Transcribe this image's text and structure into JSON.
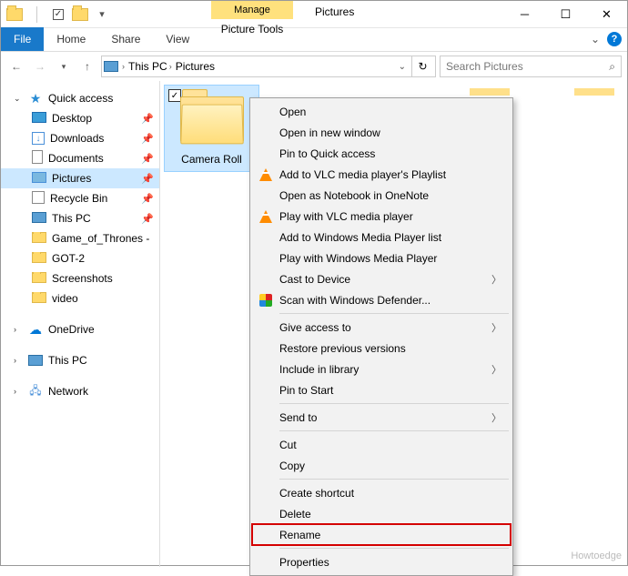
{
  "title": "Pictures",
  "ribbon": {
    "file": "File",
    "tabs": [
      "Home",
      "Share",
      "View"
    ],
    "contextual_top": "Manage",
    "contextual_bottom": "Picture Tools"
  },
  "address": {
    "segments": [
      "This PC",
      "Pictures"
    ]
  },
  "search": {
    "placeholder": "Search Pictures"
  },
  "sidebar": {
    "quick_access": "Quick access",
    "items": [
      {
        "label": "Desktop",
        "pinned": true,
        "icon": "monitor"
      },
      {
        "label": "Downloads",
        "pinned": true,
        "icon": "download"
      },
      {
        "label": "Documents",
        "pinned": true,
        "icon": "doc"
      },
      {
        "label": "Pictures",
        "pinned": true,
        "icon": "pic",
        "selected": true
      },
      {
        "label": "Recycle Bin",
        "pinned": true,
        "icon": "bin"
      },
      {
        "label": "This PC",
        "pinned": true,
        "icon": "pc"
      },
      {
        "label": "Game_of_Thrones -",
        "pinned": false,
        "icon": "folder"
      },
      {
        "label": "GOT-2",
        "pinned": false,
        "icon": "folder"
      },
      {
        "label": "Screenshots",
        "pinned": false,
        "icon": "folder"
      },
      {
        "label": "video",
        "pinned": false,
        "icon": "folder"
      }
    ],
    "onedrive": "OneDrive",
    "thispc": "This PC",
    "network": "Network"
  },
  "content": {
    "selected_item": "Camera Roll"
  },
  "context_menu": {
    "groups": [
      [
        {
          "label": "Open"
        },
        {
          "label": "Open in new window"
        },
        {
          "label": "Pin to Quick access"
        },
        {
          "label": "Add to VLC media player's Playlist",
          "icon": "cone"
        },
        {
          "label": "Open as Notebook in OneNote"
        },
        {
          "label": "Play with VLC media player",
          "icon": "cone"
        },
        {
          "label": "Add to Windows Media Player list"
        },
        {
          "label": "Play with Windows Media Player"
        },
        {
          "label": "Cast to Device",
          "submenu": true
        },
        {
          "label": "Scan with Windows Defender...",
          "icon": "shield"
        }
      ],
      [
        {
          "label": "Give access to",
          "submenu": true
        },
        {
          "label": "Restore previous versions"
        },
        {
          "label": "Include in library",
          "submenu": true
        },
        {
          "label": "Pin to Start"
        }
      ],
      [
        {
          "label": "Send to",
          "submenu": true
        }
      ],
      [
        {
          "label": "Cut"
        },
        {
          "label": "Copy"
        }
      ],
      [
        {
          "label": "Create shortcut"
        },
        {
          "label": "Delete"
        },
        {
          "label": "Rename",
          "highlight": true
        }
      ],
      [
        {
          "label": "Properties"
        }
      ]
    ]
  },
  "watermark": "Howtoedge"
}
